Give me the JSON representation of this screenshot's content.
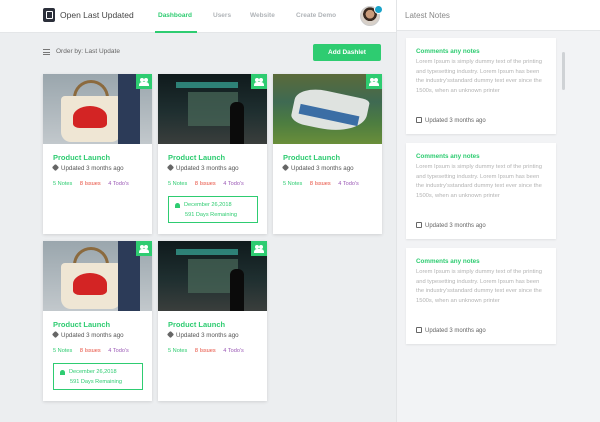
{
  "header": {
    "title": "Open Last Updated",
    "tabs": [
      {
        "label": "Dashboard",
        "active": true
      },
      {
        "label": "Users",
        "active": false
      },
      {
        "label": "Website",
        "active": false
      },
      {
        "label": "Create Demo",
        "active": false
      }
    ]
  },
  "toolbar": {
    "sort_label": "Order by: Last Update",
    "add_button": "Add Dashlet"
  },
  "cards": [
    {
      "image": "handbag",
      "title": "Product Launch",
      "updated": "Updated 3 months ago",
      "notes": "5 Notes",
      "issues": "8 Issues",
      "todos": "4 Todo's"
    },
    {
      "image": "night-store",
      "title": "Product Launch",
      "updated": "Updated 3 months ago",
      "notes": "5 Notes",
      "issues": "8 Issues",
      "todos": "4 Todo's",
      "deadline": {
        "date": "December 26,2018",
        "remaining": "591 Days Remaining"
      }
    },
    {
      "image": "boat",
      "title": "Product Launch",
      "updated": "Updated 3 months ago",
      "notes": "5 Notes",
      "issues": "8 Issues",
      "todos": "4 Todo's"
    },
    {
      "image": "handbag",
      "title": "Product Launch",
      "updated": "Updated 3 months ago",
      "notes": "5 Notes",
      "issues": "8 Issues",
      "todos": "4 Todo's",
      "deadline": {
        "date": "December 26,2018",
        "remaining": "591 Days Remaining"
      }
    },
    {
      "image": "night-store",
      "title": "Product Launch",
      "updated": "Updated 3 months ago",
      "notes": "5 Notes",
      "issues": "8 Issues",
      "todos": "4 Todo's"
    }
  ],
  "sidebar": {
    "title": "Latest Notes",
    "notes": [
      {
        "title": "Comments any notes",
        "body": "Lorem Ipsum is simply dummy text of the printing and typesetting industry. Lorem Ipsum has been the industry'sstandard dummy text ever since the 1500s, when an unknown printer",
        "updated": "Updated 3 months ago"
      },
      {
        "title": "Comments any notes",
        "body": "Lorem Ipsum is simply dummy text of the printing and typesetting industry. Lorem Ipsum has been the industry'sstandard dummy text ever since the 1500s, when an unknown printer",
        "updated": "Updated 3 months ago"
      },
      {
        "title": "Comments any notes",
        "body": "Lorem Ipsum is simply dummy text of the printing and typesetting industry. Lorem Ipsum has been the industry'sstandard dummy text ever since the 1500s, when an unknown printer",
        "updated": "Updated 3 months ago"
      }
    ]
  },
  "colors": {
    "accent": "#2ecc71",
    "issues": "#e74c3c",
    "todos": "#9b59b6"
  }
}
